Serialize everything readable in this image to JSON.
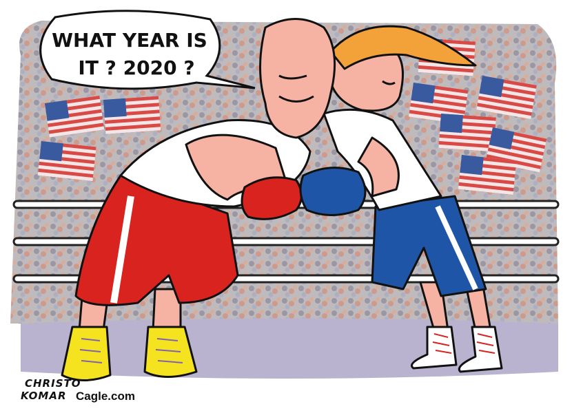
{
  "cartoon": {
    "speech_line1": "WHAT YEAR IS",
    "speech_line2": "IT ? 2020 ?",
    "signature_line1": "CHRISTO",
    "signature_line2": "KOMAR",
    "site": "Cagle.com"
  },
  "colors": {
    "red_corner": "#d8231f",
    "blue_corner": "#1f55a6",
    "skin": "#f6b2a3",
    "hair_orange": "#f3a23a",
    "ring_floor": "#b9b3cf",
    "flag_red": "#d84a45"
  }
}
